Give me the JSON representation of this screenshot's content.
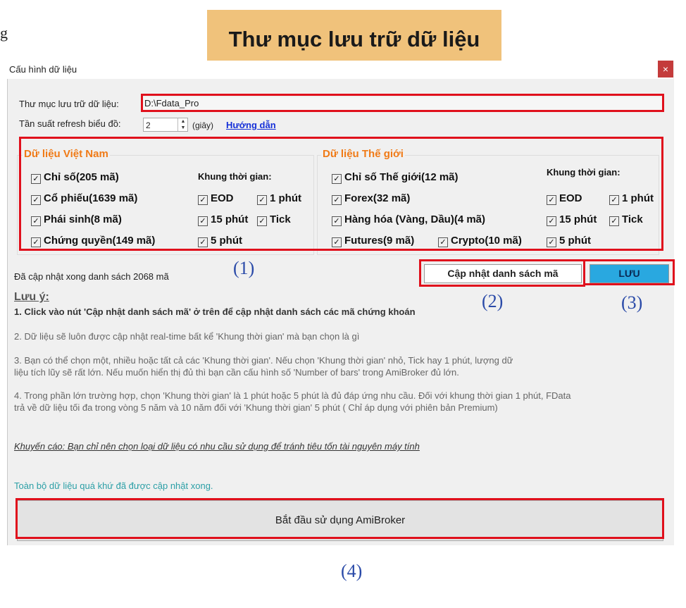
{
  "callout": {
    "text": "Thư mục lưu trữ dữ liệu"
  },
  "fragment": "g",
  "window": {
    "title": "Cấu hình dữ liệu",
    "close": "×"
  },
  "form": {
    "folder_label": "Thư mục lưu trữ dữ liệu:",
    "folder_value": "D:\\Fdata_Pro",
    "refresh_label": "Tần suất refresh biểu đồ:",
    "refresh_value": "2",
    "refresh_unit": "(giây)",
    "guide_link": "Hướng dẫn"
  },
  "vn": {
    "title": "Dữ liệu Việt Nam",
    "items": [
      "Chỉ số(205 mã)",
      "Cổ phiếu(1639 mã)",
      "Phái sinh(8 mã)",
      "Chứng quyền(149 mã)"
    ],
    "timeframe_title": "Khung thời gian:",
    "timeframes": [
      "EOD",
      "1 phút",
      "15 phút",
      "Tick",
      "5 phút"
    ]
  },
  "world": {
    "title": "Dữ liệu Thế giới",
    "items": [
      "Chỉ số Thế giới(12 mã)",
      "Forex(32 mã)",
      "Hàng hóa (Vàng, Dầu)(4 mã)",
      "Futures(9 mã)",
      "Crypto(10 mã)"
    ],
    "timeframe_title": "Khung thời gian:",
    "timeframes": [
      "EOD",
      "1 phút",
      "15 phút",
      "Tick",
      "5 phút"
    ]
  },
  "check_mark": "✓",
  "status": {
    "updated": "Đã cập nhật xong danh sách 2068 mã"
  },
  "buttons": {
    "update_list": "Cập nhật danh sách mã",
    "save": "LƯU",
    "start": "Bắt đầu sử dụng AmiBroker"
  },
  "markers": [
    "(1)",
    "(2)",
    "(3)",
    "(4)"
  ],
  "notes": {
    "heading": "Lưu ý:",
    "n1": "1. Click vào nút 'Cập nhật danh sách mã' ở trên để cập nhật danh sách các mã chứng khoán",
    "n2": "2. Dữ liệu sẽ luôn được cập nhật real-time bất kể 'Khung thời gian' mà bạn chọn là gì",
    "n3a": "3. Bạn có thể chọn một, nhiều hoặc tất cả các 'Khung thời gian'. Nếu chọn 'Khung thời gian' nhỏ, Tick hay 1 phút, lượng dữ",
    "n3b": "liệu tích lũy sẽ rất lớn.  Nếu muốn hiển thị đủ thì bạn cần cấu hình số 'Number of bars' trong AmiBroker đủ lớn.",
    "n4a": "4. Trong phần lớn trường hợp, chọn 'Khung thời gian' là 1 phút hoặc 5 phút là đủ đáp ứng nhu cầu.  Đối với khung thời gian 1 phút, FData",
    "n4b": "trả về dữ liệu tối đa trong vòng 5 năm và 10 năm đối với 'Khung thời gian' 5 phút ( Chỉ áp dụng với phiên bản Premium)",
    "advice": "Khuyến cáo: Bạn chỉ nên chọn loại dữ liệu có nhu cầu sử dụng để tránh tiêu tốn tài nguyên máy tính",
    "complete": "Toàn bộ dữ liệu quá khứ đã được cập nhật xong."
  },
  "colors": {
    "accent_orange": "#f07a16",
    "highlight_red": "#e0101c",
    "save_blue": "#29a8e0",
    "callout": "#f0c27b",
    "teal": "#2b9fa6"
  }
}
